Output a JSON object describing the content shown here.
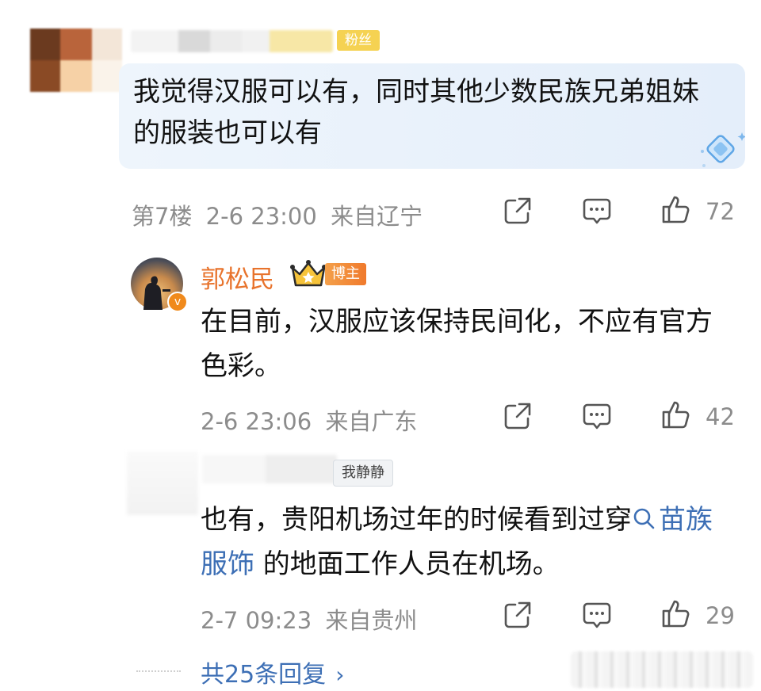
{
  "top_comment": {
    "badge": "粉丝",
    "text": "我觉得汉服可以有，同时其他少数民族兄弟姐妹的服装也可以有",
    "floor": "第7楼",
    "time": "2-6 23:00",
    "location": "来自辽宁",
    "likes": "72"
  },
  "reply_1": {
    "author": "郭松民",
    "badge": "博主",
    "text": "在目前，汉服应该保持民间化，不应有官方色彩。",
    "time": "2-6 23:06",
    "location": "来自广东",
    "likes": "42"
  },
  "reply_2": {
    "quoted_name": "我静静",
    "text_before": "也有，贵阳机场过年的时候看到过穿",
    "topic_link": "苗族服饰",
    "text_after": " 的地面工作人员在机场。",
    "time": "2-7 09:23",
    "location": "来自贵州",
    "likes": "29"
  },
  "footer": {
    "total_replies": "共25条回复"
  },
  "icons": [
    "share-icon",
    "comment-icon",
    "like-icon",
    "crown-icon",
    "search-icon",
    "chevron-right-icon",
    "gem-icon"
  ],
  "colors": {
    "author_orange": "#e8732c",
    "link_blue": "#3d6fb5",
    "meta_gray": "#8c8c8c",
    "bubble_blue": "#e8f1fb"
  }
}
